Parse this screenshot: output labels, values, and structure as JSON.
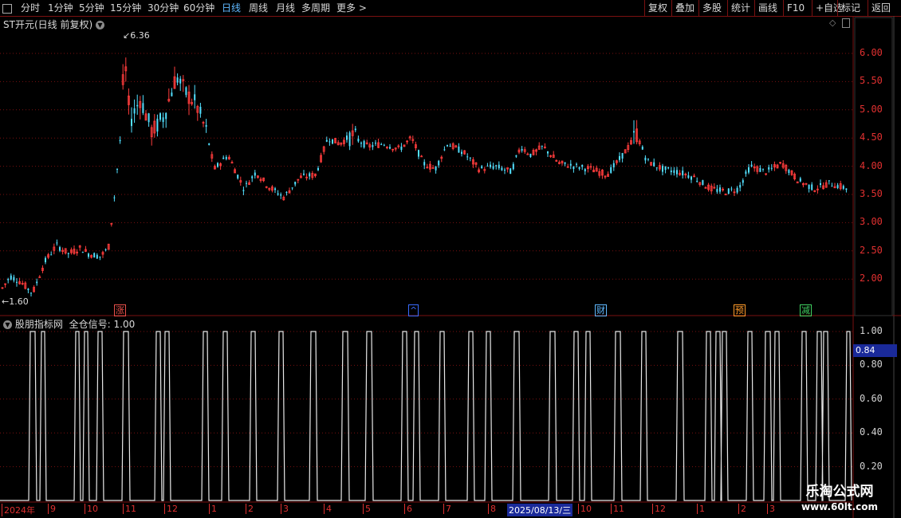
{
  "toolbar": {
    "periods": [
      "分时",
      "1分钟",
      "5分钟",
      "15分钟",
      "30分钟",
      "60分钟",
      "日线",
      "周线",
      "月线",
      "多周期",
      "更多 >"
    ],
    "active_period": "日线",
    "right_buttons": [
      "复权",
      "叠加",
      "多股",
      "统计",
      "画线",
      "F10",
      "+自选",
      "标记",
      "返回"
    ]
  },
  "main_chart": {
    "title": "ST开元(日线 前复权)",
    "high_label": "6.36",
    "low_label": "1.60",
    "price_ticks": [
      "6.00",
      "5.50",
      "5.00",
      "4.50",
      "4.00",
      "3.50",
      "3.00",
      "2.50",
      "2.00"
    ],
    "event_badges": [
      {
        "text": "涨",
        "color": "#e8504a"
      },
      {
        "text": "^",
        "color": "#3a6bff"
      },
      {
        "text": "财",
        "color": "#5fb8ff"
      },
      {
        "text": "预",
        "color": "#ff9a2a"
      },
      {
        "text": "减",
        "color": "#40d060"
      }
    ],
    "colors": {
      "up": "#ff3c3c",
      "down": "#52e0ff",
      "grid": "#7a1010",
      "axis": "#e03030"
    }
  },
  "indicator": {
    "title": "股朋指标网",
    "signal_label": "全仓信号:",
    "signal_value": "1.00",
    "ticks": [
      "1.00",
      "0.80",
      "0.60",
      "0.40",
      "0.20"
    ],
    "current_value": "0.84"
  },
  "date_axis": {
    "labels": [
      "2024年",
      "9",
      "10",
      "11",
      "12",
      "1",
      "2",
      "3",
      "4",
      "5",
      "6",
      "7",
      "8",
      "2025/08/13/三",
      "10",
      "11",
      "12",
      "1",
      "2",
      "3"
    ]
  },
  "watermark": {
    "line1": "乐淘公式网",
    "line2": "www.60lt.com"
  }
}
